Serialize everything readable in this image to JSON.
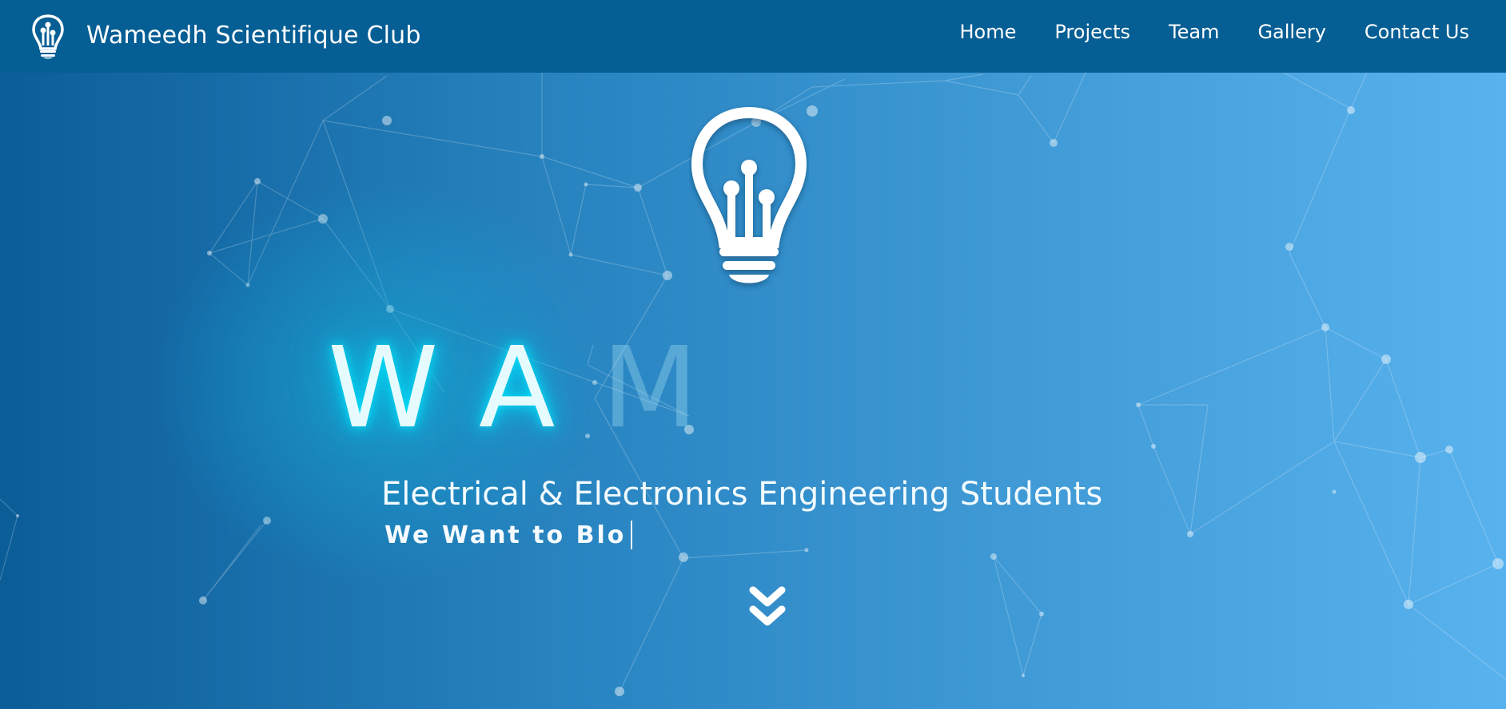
{
  "nav": {
    "brand_title": "Wameedh Scientifique Club",
    "links": [
      "Home",
      "Projects",
      "Team",
      "Gallery",
      "Contact Us"
    ]
  },
  "hero": {
    "title_lit": "WA",
    "title_dim": "M",
    "subtitle": "Electrical & Electronics Engineering Students",
    "typed_text": "We Want to Blo"
  },
  "icons": {
    "brand": "lightbulb-circuit-icon",
    "hero": "lightbulb-circuit-icon",
    "scroll": "double-chevron-down-icon"
  },
  "colors": {
    "navbar": "#055e94",
    "glow": "#00e6ff",
    "text": "#ffffff"
  }
}
